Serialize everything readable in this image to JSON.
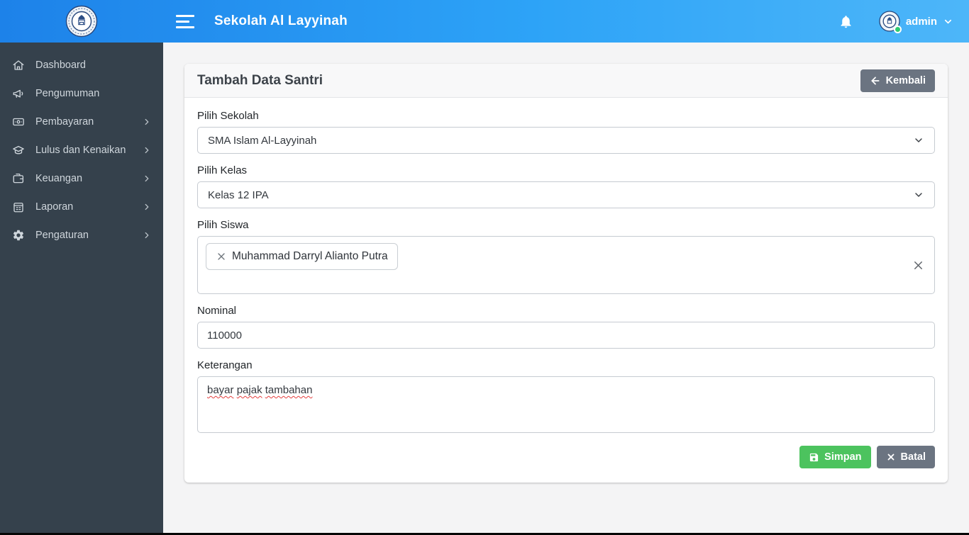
{
  "header": {
    "title": "Sekolah Al Layyinah",
    "user_name": "admin"
  },
  "sidebar": {
    "items": [
      {
        "label": "Dashboard",
        "icon": "home-icon",
        "expandable": false
      },
      {
        "label": "Pengumuman",
        "icon": "megaphone-icon",
        "expandable": false
      },
      {
        "label": "Pembayaran",
        "icon": "banknote-icon",
        "expandable": true
      },
      {
        "label": "Lulus dan Kenaikan",
        "icon": "graduation-icon",
        "expandable": true
      },
      {
        "label": "Keuangan",
        "icon": "wallet-icon",
        "expandable": true
      },
      {
        "label": "Laporan",
        "icon": "calendar-icon",
        "expandable": true
      },
      {
        "label": "Pengaturan",
        "icon": "gear-icon",
        "expandable": true
      }
    ]
  },
  "card": {
    "title": "Tambah Data Santri",
    "back_label": "Kembali"
  },
  "form": {
    "school": {
      "label": "Pilih Sekolah",
      "value": "SMA Islam Al-Layyinah"
    },
    "class": {
      "label": "Pilih Kelas",
      "value": "Kelas 12 IPA"
    },
    "student": {
      "label": "Pilih Siswa",
      "selected": "Muhammad Darryl Alianto Putra"
    },
    "nominal": {
      "label": "Nominal",
      "value": "110000"
    },
    "note": {
      "label": "Keterangan",
      "value": "bayar pajak tambahan"
    },
    "save_label": "Simpan",
    "cancel_label": "Batal"
  },
  "colors": {
    "header_gradient_start": "#1d82e9",
    "header_gradient_end": "#4db6f9",
    "sidebar_bg": "#35414c",
    "success_green": "#4cc35e",
    "secondary_gray": "#6b7481",
    "status_dot_green": "#2ecc71",
    "spellcheck_red": "#e53e3e"
  }
}
